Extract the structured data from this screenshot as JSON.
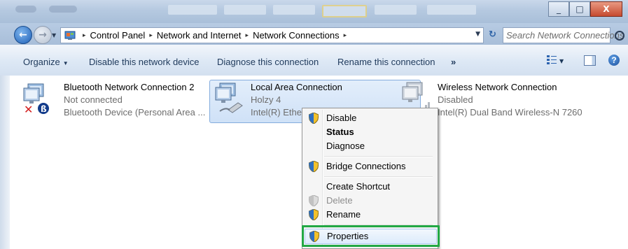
{
  "window": {
    "caption_buttons": [
      "_",
      "□",
      "X"
    ]
  },
  "address_bar": {
    "breadcrumbs": [
      "Control Panel",
      "Network and Internet",
      "Network Connections"
    ],
    "separator": "▸",
    "search_placeholder": "Search Network Connections"
  },
  "toolbar": {
    "organize": "Organize",
    "disable": "Disable this network device",
    "diagnose": "Diagnose this connection",
    "rename": "Rename this connection",
    "more": "»",
    "help": "?"
  },
  "connections": [
    {
      "name": "Bluetooth Network Connection 2",
      "status": "Not connected",
      "device": "Bluetooth Device (Personal Area ..."
    },
    {
      "name": "Local Area Connection",
      "status": "Holzy  4",
      "device": "Intel(R) Ethern",
      "selected": true
    },
    {
      "name": "Wireless Network Connection",
      "status": "Disabled",
      "device": "Intel(R) Dual Band Wireless-N 7260"
    }
  ],
  "context_menu": {
    "items": [
      {
        "label": "Disable",
        "shield": true
      },
      {
        "label": "Status",
        "bold": true
      },
      {
        "label": "Diagnose"
      },
      {
        "label": "Bridge Connections",
        "shield": true
      },
      {
        "label": "Create Shortcut"
      },
      {
        "label": "Delete",
        "shield": true,
        "disabled": true
      },
      {
        "label": "Rename",
        "shield": true
      },
      {
        "label": "Properties",
        "shield": true,
        "highlighted": true
      }
    ]
  },
  "colors": {
    "highlight_box": "#22a845",
    "selection": "#cfe1f7",
    "toolbar_text": "#1e395b"
  }
}
